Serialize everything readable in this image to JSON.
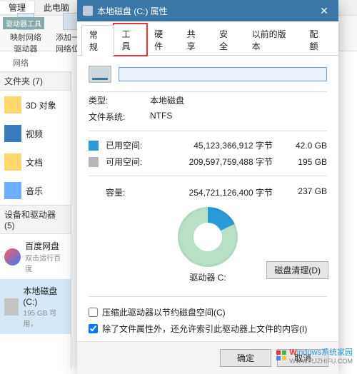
{
  "explorer": {
    "header_tabs": [
      "管理",
      "此电脑"
    ],
    "toolbar_label": "驱动器工具",
    "tools": [
      {
        "label": "映射网络\n驱动器"
      },
      {
        "label": "添加一个\n网络位置"
      }
    ],
    "group_label": "网络",
    "sections": {
      "folders_head": "文件夹 (7)",
      "devices_head": "设备和驱动器 (5)"
    },
    "folders": [
      {
        "label": "3D 对象",
        "icon": "folder"
      },
      {
        "label": "视频",
        "icon": "video"
      },
      {
        "label": "文档",
        "icon": "folder"
      },
      {
        "label": "音乐",
        "icon": "music"
      }
    ],
    "devices": [
      {
        "label": "百度网盘",
        "sub": "双击运行百度",
        "icon": "baidu"
      },
      {
        "label": "本地磁盘 (C:)",
        "sub": "195 GB 可用，",
        "icon": "disk",
        "selected": true
      }
    ]
  },
  "dialog": {
    "title": "本地磁盘 (C:) 属性",
    "tabs": [
      "常规",
      "工具",
      "硬件",
      "共享",
      "安全",
      "以前的版本",
      "配额"
    ],
    "active_tab": 0,
    "highlight_tab": 1,
    "drive_name": "",
    "type_label": "类型:",
    "type_value": "本地磁盘",
    "fs_label": "文件系统:",
    "fs_value": "NTFS",
    "used_label": "已用空间:",
    "used_bytes": "45,123,366,912 字节",
    "used_gb": "42.0 GB",
    "free_label": "可用空间:",
    "free_bytes": "209,597,759,488 字节",
    "free_gb": "195 GB",
    "capacity_label": "容量:",
    "capacity_bytes": "254,721,126,400 字节",
    "capacity_gb": "237 GB",
    "drive_label": "驱动器 C:",
    "cleanup_btn": "磁盘清理(D)",
    "chk1": "压缩此驱动器以节约磁盘空间(C)",
    "chk2": "除了文件属性外，还允许索引此驱动器上文件的内容(I)",
    "chk2_checked": true,
    "ok": "确定",
    "cancel": "取消"
  },
  "watermark": {
    "text1": "indows系统家园",
    "text2": "WWW.RJZHIFU.COM"
  },
  "chart_data": {
    "type": "pie",
    "title": "驱动器 C:",
    "series": [
      {
        "name": "已用空间",
        "value": 42.0,
        "unit": "GB",
        "color": "#2a9bd6"
      },
      {
        "name": "可用空间",
        "value": 195,
        "unit": "GB",
        "color": "#b8e0c7"
      }
    ],
    "total": {
      "label": "容量",
      "value": 237,
      "unit": "GB"
    }
  }
}
